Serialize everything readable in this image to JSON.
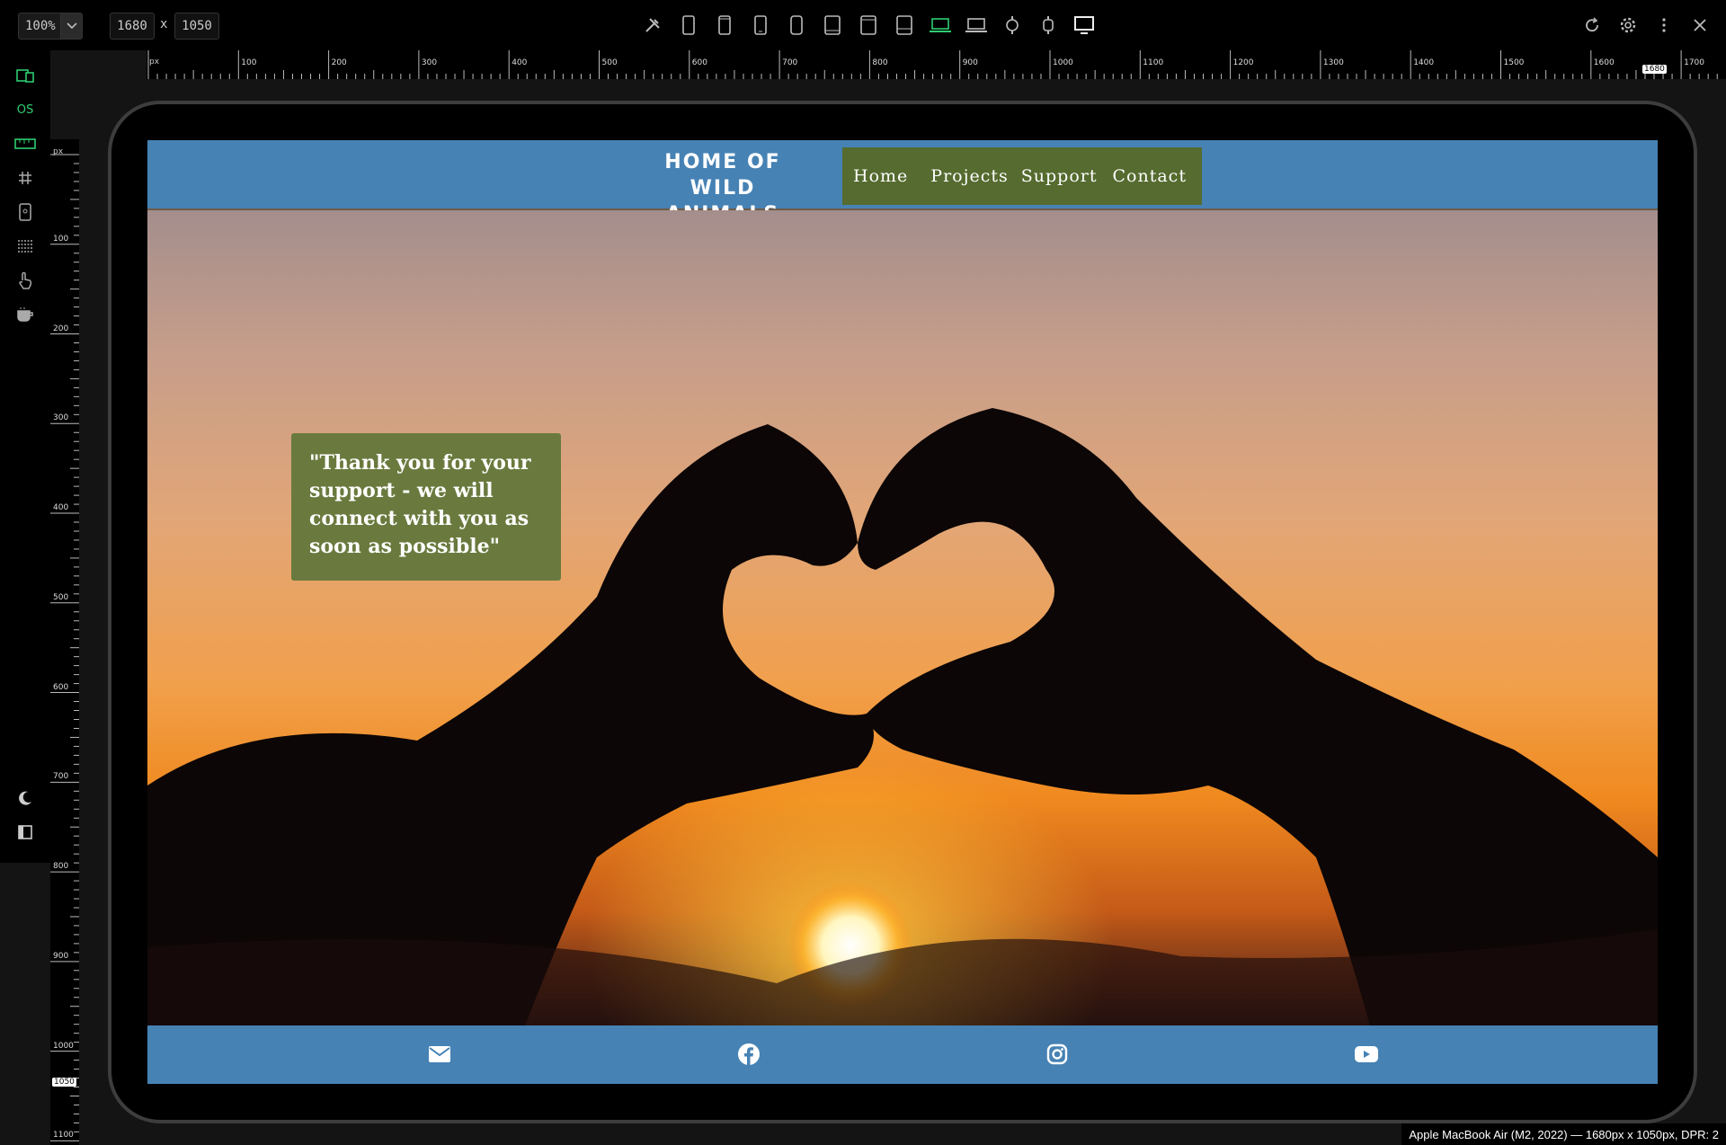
{
  "toolbar": {
    "zoom": "100%",
    "width": "1680",
    "x_sep": "x",
    "height": "1050",
    "device_icons": [
      "tools-icon",
      "phone-icon",
      "phone-icon",
      "phone-icon",
      "phone-icon",
      "tablet-icon",
      "tablet-icon",
      "tablet-icon",
      "laptop-icon",
      "laptop-icon",
      "watch-icon",
      "watch-icon",
      "monitor-icon"
    ],
    "right_icons": [
      "refresh-icon",
      "gear-icon",
      "more-icon",
      "close-icon"
    ]
  },
  "sidebar": {
    "os_label": "OS",
    "icons": [
      "devices-icon",
      "os-icon",
      "ruler-icon",
      "grid-icon",
      "device-frame-icon",
      "lines-icon",
      "touch-icon",
      "coffee-icon",
      "moon-icon",
      "sidebar-icon"
    ]
  },
  "rulers": {
    "unit": "px",
    "h_labels": [
      "100",
      "200",
      "300",
      "400",
      "500",
      "600",
      "700",
      "800",
      "900",
      "1000",
      "1100",
      "1200",
      "1300",
      "1400",
      "1500",
      "1600",
      "1700"
    ],
    "h_marker": "1680",
    "v_labels": [
      "100",
      "200",
      "300",
      "400",
      "500",
      "600",
      "700",
      "800",
      "900",
      "1000",
      "1100"
    ],
    "v_marker": "1050"
  },
  "site": {
    "logo": "HOME OF WILD ANIMALS",
    "nav": [
      "Home",
      "Projects",
      "Support",
      "Contact"
    ],
    "quote": "\"Thank you for your support - we will connect with you as soon as possible\"",
    "footer_icons": [
      "envelope-icon",
      "facebook-icon",
      "instagram-icon",
      "youtube-icon"
    ],
    "colors": {
      "header": "#4682b4",
      "nav": "#556b2f",
      "quote_box": "#6a7a3e"
    }
  },
  "status": "Apple MacBook Air (M2, 2022) — 1680px x 1050px, DPR: 2",
  "colors": {
    "accent": "#2ecc71",
    "panel": "#000000"
  }
}
